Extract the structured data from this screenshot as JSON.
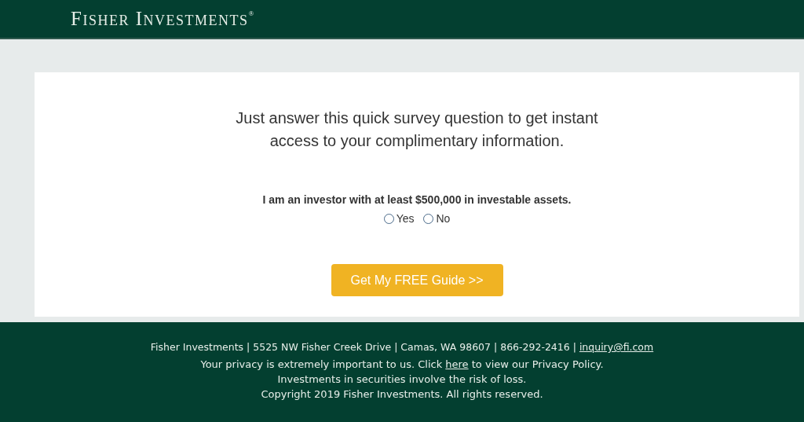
{
  "header": {
    "logo": "Fisher Investments$^{®}$"
  },
  "survey": {
    "intro": "Just answer this quick survey question to get instant access to your complimentary information.",
    "question": "I am an investor with at least $500,000 in investable assets.",
    "options": [
      {
        "label": "Yes",
        "selected": false
      },
      {
        "label": "No",
        "selected": false
      }
    ],
    "submit": "Get My FREE Guide >>"
  },
  "footer": {
    "address": {
      "text": "Fisher Investments | 5525 NW Fisher Creek Drive | Camas, WA 98607 | 866-292-2416 | ",
      "link": "inquiry@fi.com"
    },
    "privacy": {
      "before": "Your privacy is extremely important to us. Click ",
      "link": "here",
      "after": " to view our Privacy Policy."
    },
    "lines": [
      "Investments in securities involve the risk of loss.",
      "Copyright 2019 Fisher Investments. All rights reserved."
    ]
  }
}
